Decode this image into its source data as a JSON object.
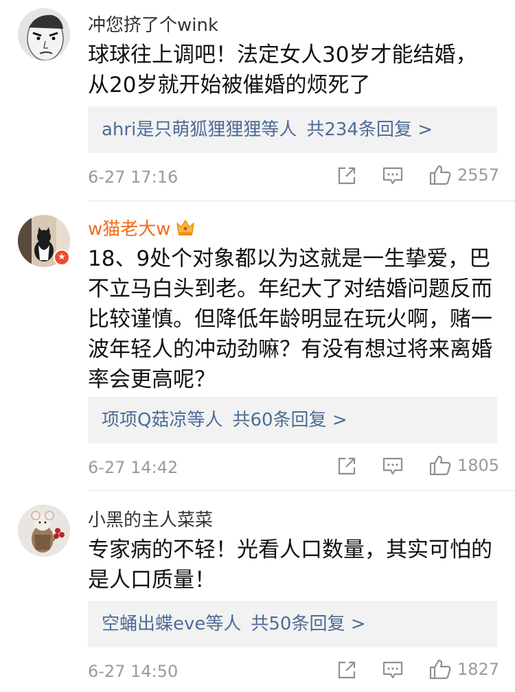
{
  "comments": [
    {
      "username": "冲您挤了个wink",
      "text": "球球往上调吧！法定女人30岁才能结婚，从20岁就开始被催婚的烦死了",
      "reply_users": "ahri是只萌狐狸狸狸等人",
      "reply_count": "共234条回复 >",
      "time": "6-27 17:16",
      "likes": "2557"
    },
    {
      "username": "w猫老大w",
      "text": "18、9处个对象都以为这就是一生挚爱，巴不立马白头到老。年纪大了对结婚问题反而比较谨慎。但降低年龄明显在玩火啊，赌一波年轻人的冲动劲嘛？有没有想过将来离婚率会更高呢？",
      "reply_users": "项项Q菇凉等人",
      "reply_count": "共60条回复 >",
      "time": "6-27 14:42",
      "likes": "1805"
    },
    {
      "username": "小黑的主人菜菜",
      "text": "专家病的不轻！光看人口数量，其实可怕的是人口质量！",
      "reply_users": "空蛹出蝶eve等人",
      "reply_count": "共50条回复 >",
      "time": "6-27 14:50",
      "likes": "1827"
    }
  ],
  "icons": [
    "share-icon",
    "comment-icon",
    "like-icon",
    "crown-icon",
    "verified-badge-icon"
  ],
  "colors": {
    "link": "#4d6c96",
    "vip_name": "#f26a1b",
    "meta": "#9a9a9a",
    "reply_bg": "#f2f2f2"
  }
}
